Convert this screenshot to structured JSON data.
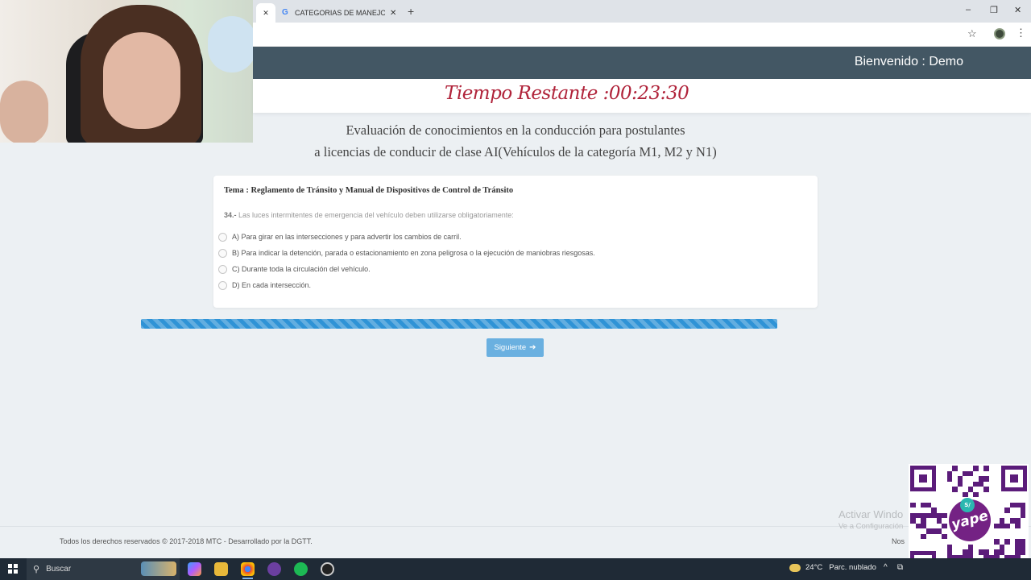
{
  "browser": {
    "tabs": [
      {
        "title": "",
        "close": "✕"
      },
      {
        "title": "CATEGORIAS DE MANEJO - Buscar",
        "close": "✕"
      }
    ],
    "new_tab": "+",
    "window_controls": {
      "minimize": "–",
      "restore": "❐",
      "close": "✕"
    },
    "star": "☆",
    "menu": "⋮"
  },
  "header": {
    "welcome": "Bienvenido : Demo"
  },
  "timer": {
    "label": "Tiempo Restante :00:23:30"
  },
  "exam": {
    "title_line1": "Evaluación de conocimientos en la conducción para postulantes",
    "title_line2": "a licencias de conducir de clase AI(Vehículos de la categoría M1, M2 y N1)"
  },
  "question": {
    "tema": "Tema : Reglamento de Tránsito y Manual de Dispositivos de Control de Tránsito",
    "number": "34.-",
    "text": " Las luces intermitentes de emergencia del vehículo deben utilizarse obligatoriamente:",
    "options": [
      "A) Para girar en las intersecciones y para advertir los cambios de carril.",
      "B) Para indicar la detención, parada o estacionamiento en zona peligrosa o la ejecución de maniobras riesgosas.",
      "C) Durante toda la circulación del vehículo.",
      "D) En cada intersección."
    ],
    "selected": null
  },
  "progress": {
    "percent": 100,
    "color": "#2f93d6"
  },
  "next_button": {
    "label": "Siguiente",
    "icon": "arrow-right-icon",
    "arrow": "➔"
  },
  "footer": {
    "copyright": "Todos los derechos reservados © 2017-2018 MTC - Desarrollado por la DGTT.",
    "right": "Nos"
  },
  "windows_watermark": {
    "line1": "Activar Windo",
    "line2": "Ve a Configuración"
  },
  "qr_overlay": {
    "logo_text": "yape",
    "badge": "S/"
  },
  "taskbar": {
    "search_label": "Buscar",
    "search_icon": "⚲",
    "weather": {
      "temp": "24°C",
      "condition": "Parc. nublado"
    },
    "chevron": "^",
    "tray": "⧉"
  },
  "colors": {
    "header_bg": "#435764",
    "timer": "#b0233a",
    "page_bg": "#ecf0f3",
    "button": "#6ab0e0"
  }
}
